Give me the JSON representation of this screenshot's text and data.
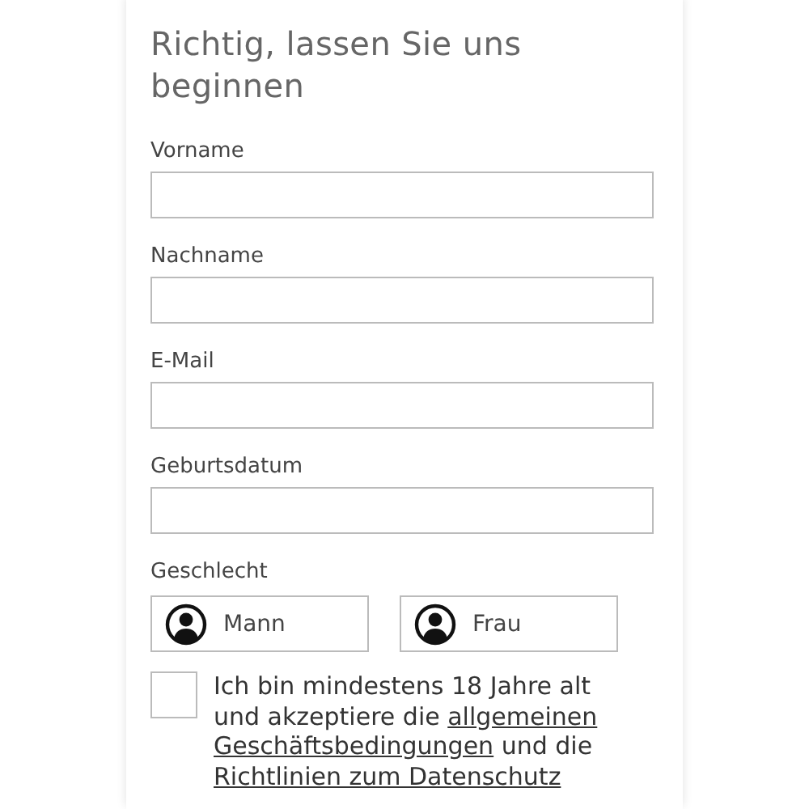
{
  "title": "Richtig, lassen Sie uns beginnen",
  "fields": [
    {
      "label": "Vorname"
    },
    {
      "label": "Nachname"
    },
    {
      "label": "E-Mail"
    },
    {
      "label": "Geburtsdatum"
    }
  ],
  "gender": {
    "label": "Geschlecht",
    "options": [
      {
        "label": "Mann",
        "selected": false
      },
      {
        "label": "Frau",
        "selected": false
      }
    ]
  },
  "consent": {
    "checked": false,
    "parts": [
      {
        "kind": "text",
        "text": "Ich bin mindestens 18 Jahre alt und akzeptiere die "
      },
      {
        "kind": "link",
        "text": "allgemeinen"
      },
      {
        "kind": "link",
        "text": "Geschäftsbedingungen"
      },
      {
        "kind": "text",
        "text": " und die "
      },
      {
        "kind": "link",
        "text": "Richtlinien zum Datenschutz"
      }
    ]
  }
}
